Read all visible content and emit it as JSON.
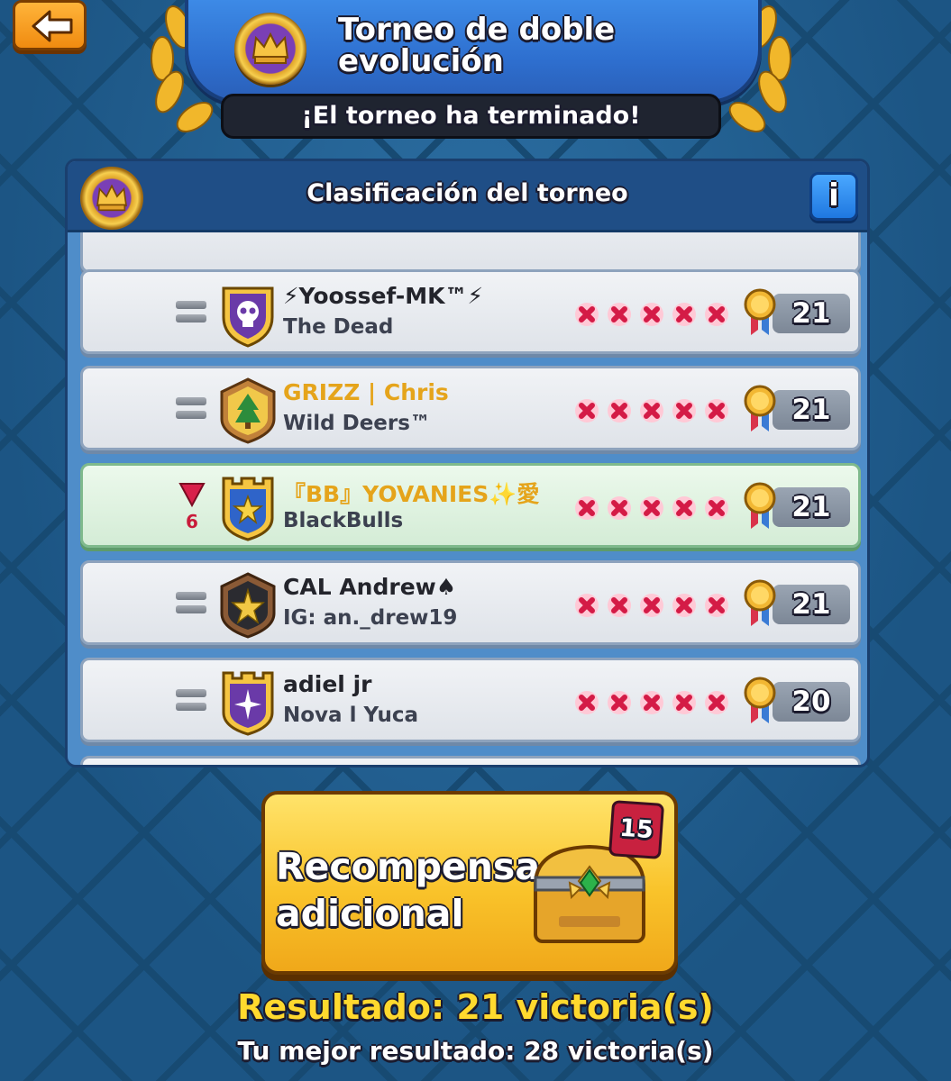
{
  "header": {
    "title": "Torneo de doble evolución",
    "status": "¡El torneo ha terminado!"
  },
  "leaderboard": {
    "title": "Clasificación del torneo",
    "info_label": "i",
    "rows": [
      {
        "name": "⚡Yoossef-MK™⚡",
        "clan": "The Dead",
        "wins": "21",
        "rank_change": "",
        "badge": "skull-shield-badge"
      },
      {
        "name": "GRIZZ | Chris",
        "clan": "Wild Deers™",
        "wins": "21",
        "rank_change": "",
        "badge": "tree-shield-badge"
      },
      {
        "name": "『BB』YOVANIES✨愛",
        "clan": "BlackBulls",
        "wins": "21",
        "rank_change": "6",
        "badge": "star-tower-badge"
      },
      {
        "name": "CAL Andrew♠",
        "clan": "IG: an._drew19",
        "wins": "21",
        "rank_change": "",
        "badge": "star-shield-badge"
      },
      {
        "name": "adiel jr",
        "clan": "Nova l Yuca",
        "wins": "20",
        "rank_change": "",
        "badge": "burst-tower-badge"
      }
    ]
  },
  "rewards": {
    "label": "Recompensa adicional",
    "chest_count": "15"
  },
  "result": "Resultado: 21 victoria(s)",
  "best_result": "Tu mejor resultado: 28 victoria(s)"
}
